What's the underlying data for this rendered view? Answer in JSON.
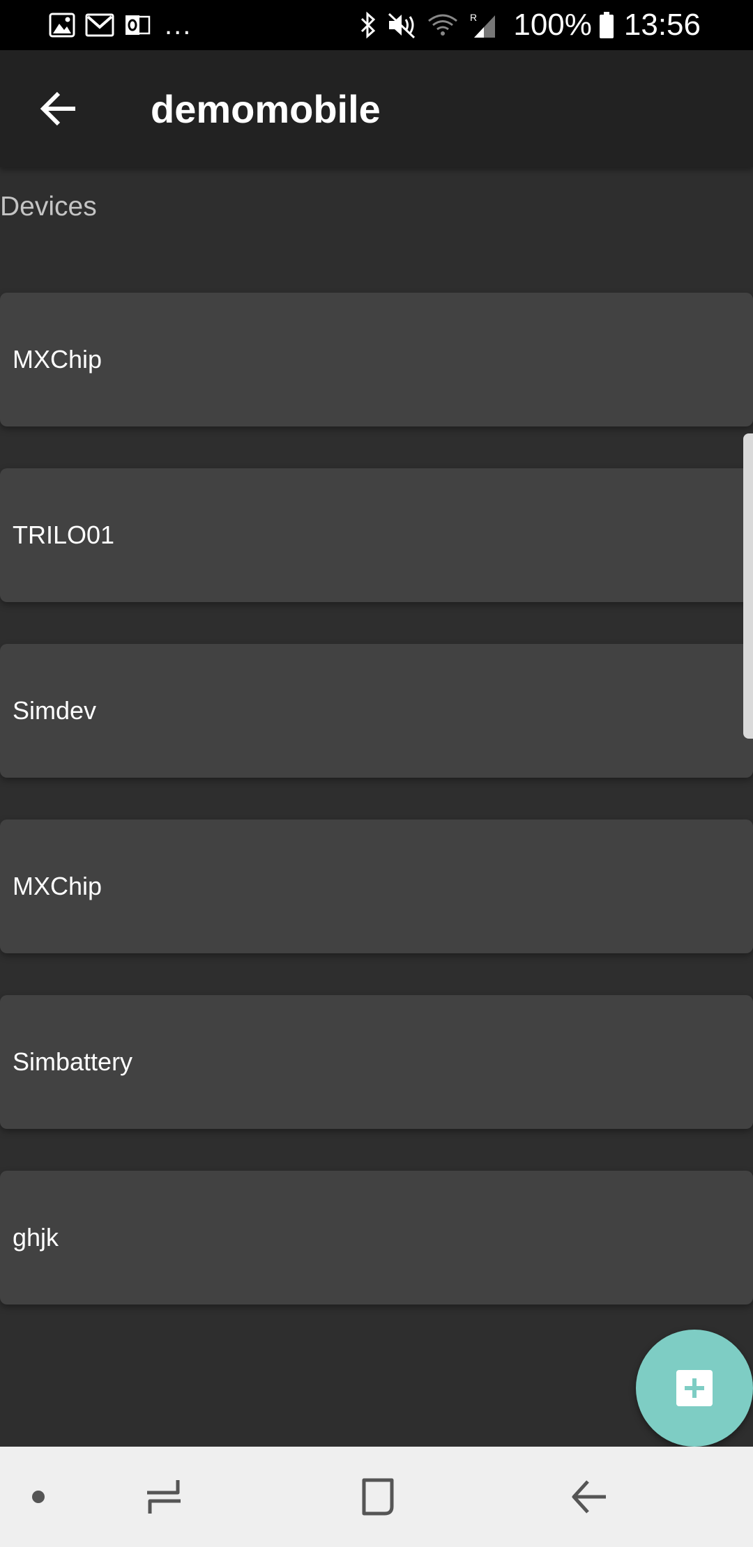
{
  "status_bar": {
    "icons_left": [
      "gallery-icon",
      "gmail-icon",
      "outlook-icon"
    ],
    "more": "...",
    "icons_right": [
      "bluetooth-icon",
      "mute-icon",
      "wifi-icon",
      "signal-icon",
      "battery-icon"
    ],
    "battery": "100%",
    "time": "13:56"
  },
  "app_bar": {
    "back_icon": "arrow-back-icon",
    "title": "demomobile"
  },
  "section": {
    "label": "Devices"
  },
  "devices": [
    {
      "name": "MXChip"
    },
    {
      "name": "TRILO01"
    },
    {
      "name": "Simdev"
    },
    {
      "name": "MXChip"
    },
    {
      "name": "Simbattery"
    },
    {
      "name": "ghjk"
    }
  ],
  "fab": {
    "icon": "add-icon"
  },
  "nav_bar": {
    "items": [
      "nav-dot-icon",
      "recent-apps-icon",
      "home-icon",
      "back-icon"
    ]
  },
  "colors": {
    "background": "#2e2e2e",
    "app_bar": "#222222",
    "card": "#424242",
    "accent": "#7ecdc4",
    "nav_bar": "#efefef"
  }
}
